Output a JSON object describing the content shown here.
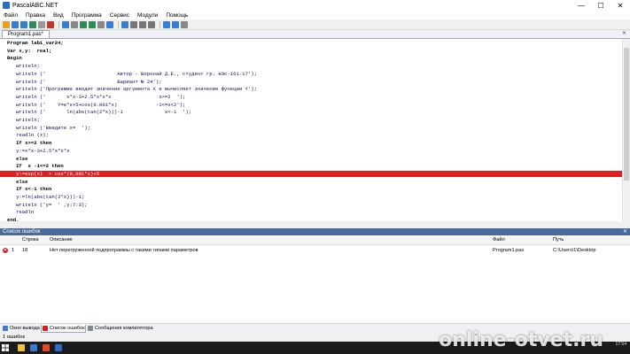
{
  "window": {
    "title": "PascalABC.NET",
    "controls": [
      "—",
      "☐",
      "✕"
    ]
  },
  "menu": [
    "Файл",
    "Правка",
    "Вид",
    "Программа",
    "Сервис",
    "Модули",
    "Помощь"
  ],
  "toolbar": {
    "icon_colors": [
      "#e8a020",
      "#3b7bd0",
      "#3b7bd0",
      "#2e8b57",
      "#999999",
      "#c0392b",
      "#3b7bd0",
      "#888888",
      "#2e8b57",
      "#2e8b57",
      "#888888",
      "#3b7bd0",
      "#3b7bd0",
      "#777777",
      "#777777",
      "#777777",
      "#3b7bd0",
      "#3b7bd0",
      "#888888"
    ]
  },
  "tabs": {
    "active": "Program1.pas*",
    "close": "✕"
  },
  "editor": {
    "lines": [
      {
        "text": "Program lab1_var24;",
        "kind": "kw"
      },
      {
        "text": "Var x,y:  real;",
        "kind": "kw"
      },
      {
        "text": "Begin",
        "kind": "kw"
      },
      {
        "text": "   writeln;",
        "kind": ""
      },
      {
        "text": "   writeln ('                        Автор - Воронай Д.Е., студент гр. НЭс-161-17');",
        "kind": ""
      },
      {
        "text": "   writeln ('                        Вариант № 24');",
        "kind": ""
      },
      {
        "text": "   writeln ('Программа вводит значение аргумента X и вычисляет значение функции Y');",
        "kind": ""
      },
      {
        "text": "   writeln ('       x*x-3+2.5*x*x*x                x>=2  ');",
        "kind": ""
      },
      {
        "text": "   writeln ('    Y=e*x+5+cos(0.001*x)             -1<=x<2');",
        "kind": ""
      },
      {
        "text": "   writeln ('       ln(abs(tan(2*x)))-1              x<-1  ');",
        "kind": ""
      },
      {
        "text": "   writeln;",
        "kind": ""
      },
      {
        "text": "   writeln ('Введите x=  ');",
        "kind": ""
      },
      {
        "text": "   readln (x);",
        "kind": ""
      },
      {
        "text": "   If x>=2 then",
        "kind": "kw"
      },
      {
        "text": "   y:=x*x-3+2.5*x*x*x",
        "kind": ""
      },
      {
        "text": "   else",
        "kind": "kw"
      },
      {
        "text": "   If  x -1<=2 then",
        "kind": "kw"
      },
      {
        "text": "   y:=exp(x)  + cos*(0,001*x)+5",
        "kind": "err"
      },
      {
        "text": "   else",
        "kind": "kw"
      },
      {
        "text": "   If x<-1 then",
        "kind": "kw"
      },
      {
        "text": "   y:=ln(abs(tan(2*x)))-1;",
        "kind": ""
      },
      {
        "text": "   writeln ('y=  ' ,y:7:3);",
        "kind": ""
      },
      {
        "text": "   readln",
        "kind": ""
      },
      {
        "text": "end.",
        "kind": "kw"
      }
    ]
  },
  "errors_panel": {
    "title": "Список ошибок",
    "pin": "✕",
    "columns": {
      "line": "Строка",
      "description": "Описание",
      "file": "Файл",
      "path": "Путь"
    },
    "rows": [
      {
        "index": "1",
        "line": "18",
        "description": "Нет перегруженной подпрограммы с такими типами параметров",
        "file": "Program1.pas",
        "path": "C:\\Users\\1\\Desktop"
      }
    ]
  },
  "bottom_tabs": [
    "Окно вывода",
    "Список ошибок",
    "Сообщения компилятора"
  ],
  "bottom_tab_colors": [
    "#3b7bd0",
    "#d42222",
    "#888888"
  ],
  "status": "1 ошибок",
  "taskbar": {
    "icon_colors": [
      "#f0c040",
      "#3b7bd0",
      "#e04a20",
      "#2b6cc4"
    ],
    "tray_time": "17:54"
  },
  "watermark": "online-otvet.ru",
  "colors": {
    "error_line": "#e02020",
    "panel_header": "#4a6a9a"
  }
}
